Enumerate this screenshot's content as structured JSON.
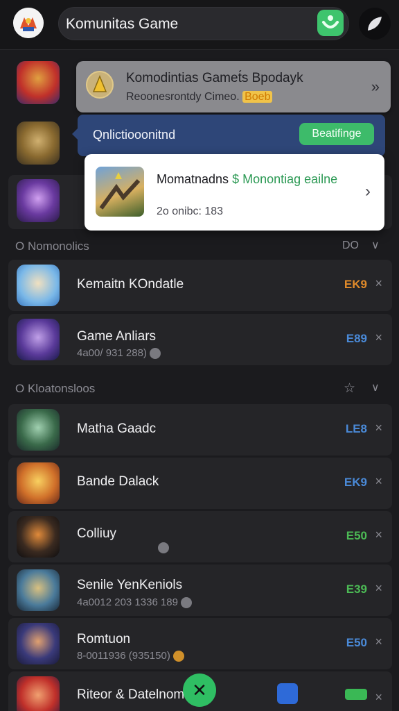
{
  "header": {
    "search_value": "Komunitas Game"
  },
  "popup": {
    "top_card": {
      "title": "Komodintias Gamet́s Bpodayk",
      "subtitle": "Reoonesrontdy Cimeo.",
      "tag": "Boeb",
      "chevron": "»"
    },
    "blue_card": {
      "label": "Qnlictiooonitnd",
      "button": "Beatifinge"
    },
    "white_card": {
      "title_part1": "Momatnadns ",
      "title_green": "$ Monontiag eailne",
      "meta": "2o onibc: 183",
      "chevron": "›"
    }
  },
  "sections": [
    {
      "label": "O Nomonolics",
      "right": "DO",
      "chevron": "∨"
    },
    {
      "label": "O Kloatonsloos",
      "right": "☆",
      "chevron": "∨"
    }
  ],
  "rows": [
    {
      "title": "Kemaitn KOndatle",
      "meta": "",
      "status": "EK9",
      "status_color": "#e08a2a"
    },
    {
      "title": "Game Anliars",
      "meta": "4a00/ 931 288)",
      "status": "E89",
      "status_color": "#4a8ad8"
    },
    {
      "title": "Matha Gaadc",
      "meta": "",
      "status": "LE8",
      "status_color": "#4a8ad8"
    },
    {
      "title": "Bande Dalack",
      "meta": "",
      "status": "EK9",
      "status_color": "#4a8ad8"
    },
    {
      "title": "Colliuy",
      "meta": "",
      "status": "E50",
      "status_color": "#4cbb55"
    },
    {
      "title": "Senile YenKeniols",
      "meta": "4a0012 203 1336 189",
      "status": "E39",
      "status_color": "#4cbb55"
    },
    {
      "title": "Romtuon",
      "meta": "8-0011936 (935150)",
      "status": "E50",
      "status_color": "#4a8ad8"
    },
    {
      "title": "Riteor & Datelnom",
      "meta": "",
      "status": "",
      "status_color": "#4cbb55"
    }
  ],
  "close_glyph": "×",
  "fab_glyph": "✕",
  "colors": {
    "background": "#1b1b1e",
    "accent_green": "#3ec46d",
    "popup_blue": "#2e4678"
  }
}
